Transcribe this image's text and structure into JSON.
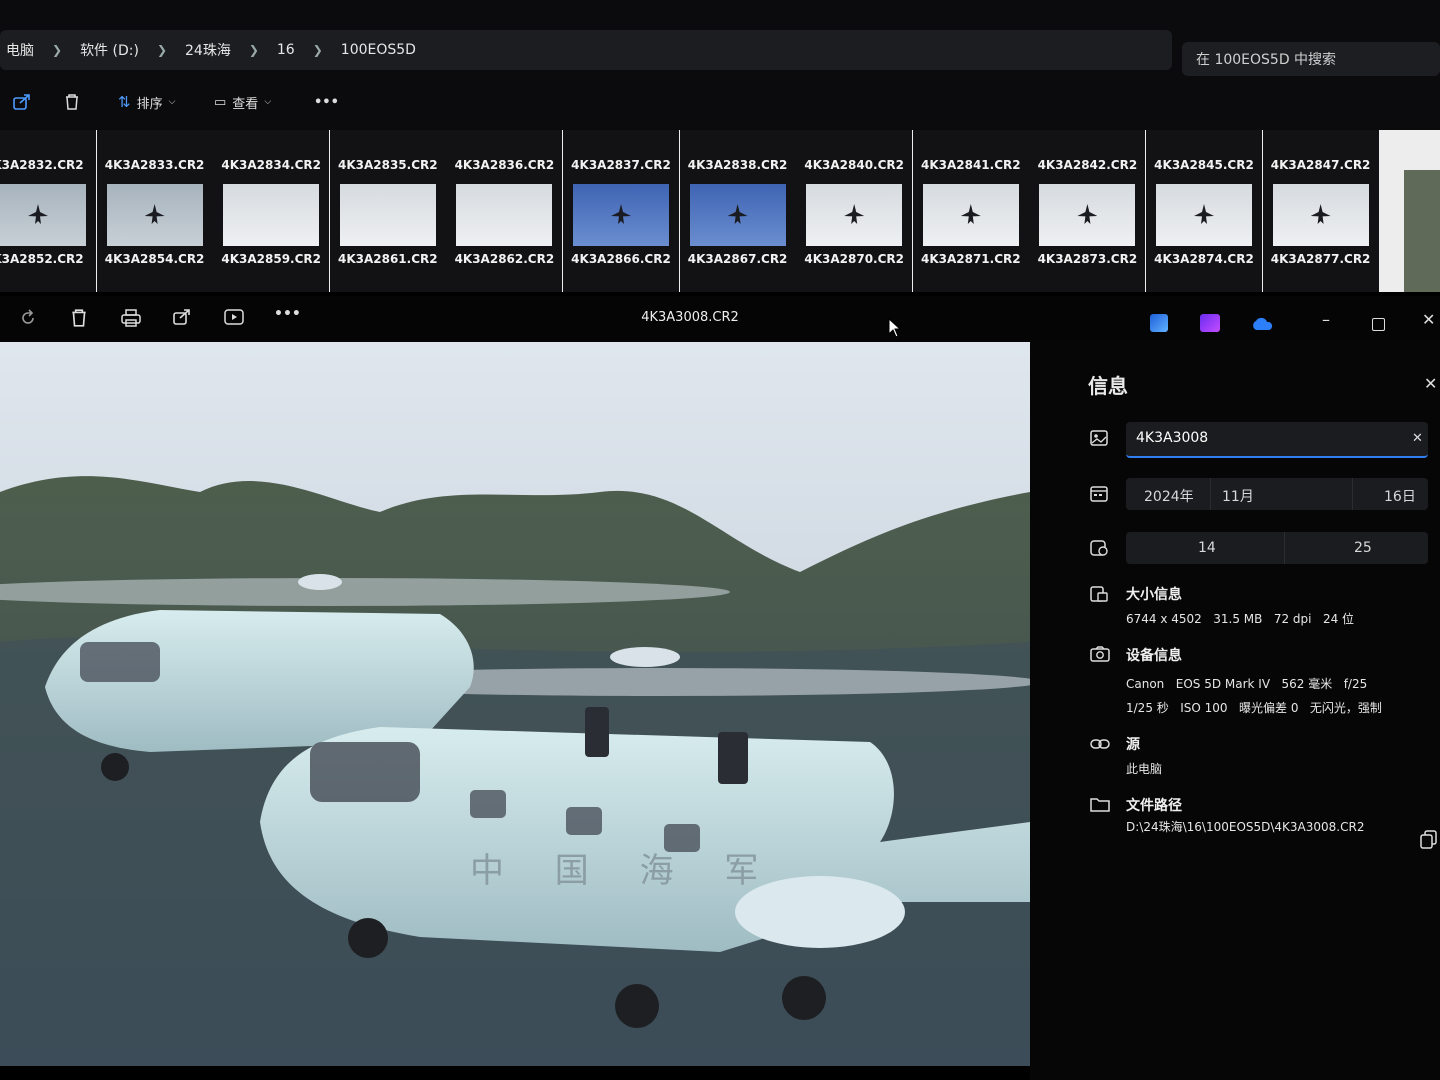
{
  "explorer": {
    "breadcrumb": [
      "电脑",
      "软件 (D:)",
      "24珠海",
      "16",
      "100EOS5D"
    ],
    "search_placeholder": "在 100EOS5D 中搜索",
    "toolbar": {
      "sort_label": "排序",
      "view_label": "查看",
      "more_label": "•••"
    }
  },
  "thumbnails": {
    "top_row": [
      "K3A2832.CR2",
      "4K3A2833.CR2",
      "4K3A2834.CR2",
      "4K3A2835.CR2",
      "4K3A2836.CR2",
      "4K3A2837.CR2",
      "4K3A2838.CR2",
      "4K3A2840.CR2",
      "4K3A2841.CR2",
      "4K3A2842.CR2",
      "4K3A2845.CR2",
      "4K3A2847.CR2"
    ],
    "bottom_row": [
      "K3A2852.CR2",
      "4K3A2854.CR2",
      "4K3A2859.CR2",
      "4K3A2861.CR2",
      "4K3A2862.CR2",
      "4K3A2866.CR2",
      "4K3A2867.CR2",
      "4K3A2870.CR2",
      "4K3A2871.CR2",
      "4K3A2873.CR2",
      "4K3A2874.CR2",
      "4K3A2877.CR2"
    ]
  },
  "viewer": {
    "title": "4K3A3008.CR2",
    "more_label": "•••",
    "colors": {
      "accent_blue": "#2f7ff2",
      "purple": "#8a3cf0",
      "cloud": "#2d7ff9"
    }
  },
  "info_panel": {
    "heading": "信息",
    "filename_value": "4K3A3008",
    "date": {
      "year": "2024年",
      "month": "11月",
      "day": "16日"
    },
    "time": {
      "hour": "14",
      "minute": "25"
    },
    "size_section": {
      "label": "大小信息",
      "dimensions": "6744 x 4502",
      "file_size": "31.5 MB",
      "dpi": "72 dpi",
      "bit_depth": "24 位"
    },
    "device_section": {
      "label": "设备信息",
      "make": "Canon",
      "model": "EOS 5D Mark IV",
      "focal": "562 毫米",
      "aperture": "f/25",
      "shutter": "1/25 秒",
      "iso": "ISO 100",
      "exposure_bias": "曝光偏差 0",
      "flash": "无闪光，强制"
    },
    "source_section": {
      "label": "源",
      "value": "此电脑"
    },
    "path_section": {
      "label": "文件路径",
      "value": "D:\\24珠海\\16\\100EOS5D\\4K3A3008.CR2"
    }
  },
  "photo": {
    "markings": "中 国 海 军"
  }
}
